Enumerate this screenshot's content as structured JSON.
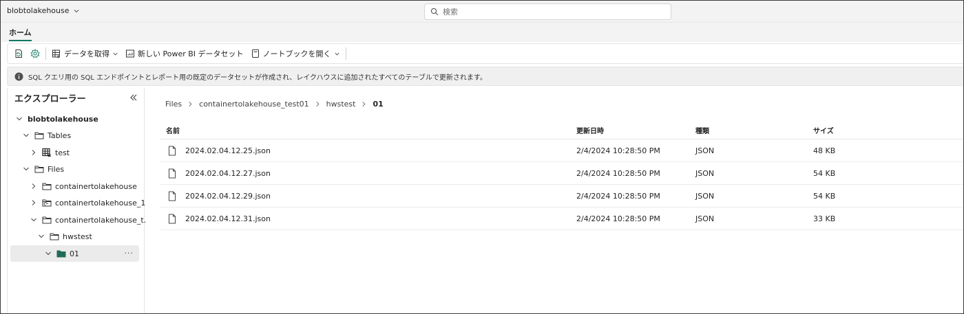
{
  "topbar": {
    "workspace": "blobtolakehouse",
    "search_placeholder": "検索"
  },
  "tabs": {
    "home": "ホーム"
  },
  "ribbon": {
    "refresh_icon": "refresh-icon",
    "settings_icon": "settings-icon",
    "get_data": "データを取得",
    "new_dataset": "新しい Power BI データセット",
    "open_notebook": "ノートブックを開く"
  },
  "infobar": {
    "message": "SQL クエリ用の SQL エンドポイントとレポート用の既定のデータセットが作成され、レイクハウスに追加されたすべてのテーブルで更新されます。"
  },
  "explorer": {
    "title": "エクスプローラー",
    "root": "blobtolakehouse",
    "tables_label": "Tables",
    "table_test": "test",
    "files_label": "Files",
    "folder1": "containertolakehouse",
    "folder2": "containertolakehouse_1",
    "folder3": "containertolakehouse_t...",
    "hwstest": "hwstest",
    "folder01": "01",
    "more": "···"
  },
  "breadcrumb": [
    "Files",
    "containertolakehouse_test01",
    "hwstest",
    "01"
  ],
  "table": {
    "headers": {
      "name": "名前",
      "modified": "更新日時",
      "type": "種類",
      "size": "サイズ"
    },
    "rows": [
      {
        "name": "2024.02.04.12.25.json",
        "modified": "2/4/2024 10:28:50 PM",
        "type": "JSON",
        "size": "48 KB"
      },
      {
        "name": "2024.02.04.12.27.json",
        "modified": "2/4/2024 10:28:50 PM",
        "type": "JSON",
        "size": "54 KB"
      },
      {
        "name": "2024.02.04.12.29.json",
        "modified": "2/4/2024 10:28:50 PM",
        "type": "JSON",
        "size": "54 KB"
      },
      {
        "name": "2024.02.04.12.31.json",
        "modified": "2/4/2024 10:28:50 PM",
        "type": "JSON",
        "size": "33 KB"
      }
    ]
  },
  "colors": {
    "accent": "#117865",
    "folder_selected": "#1f6b5a"
  }
}
